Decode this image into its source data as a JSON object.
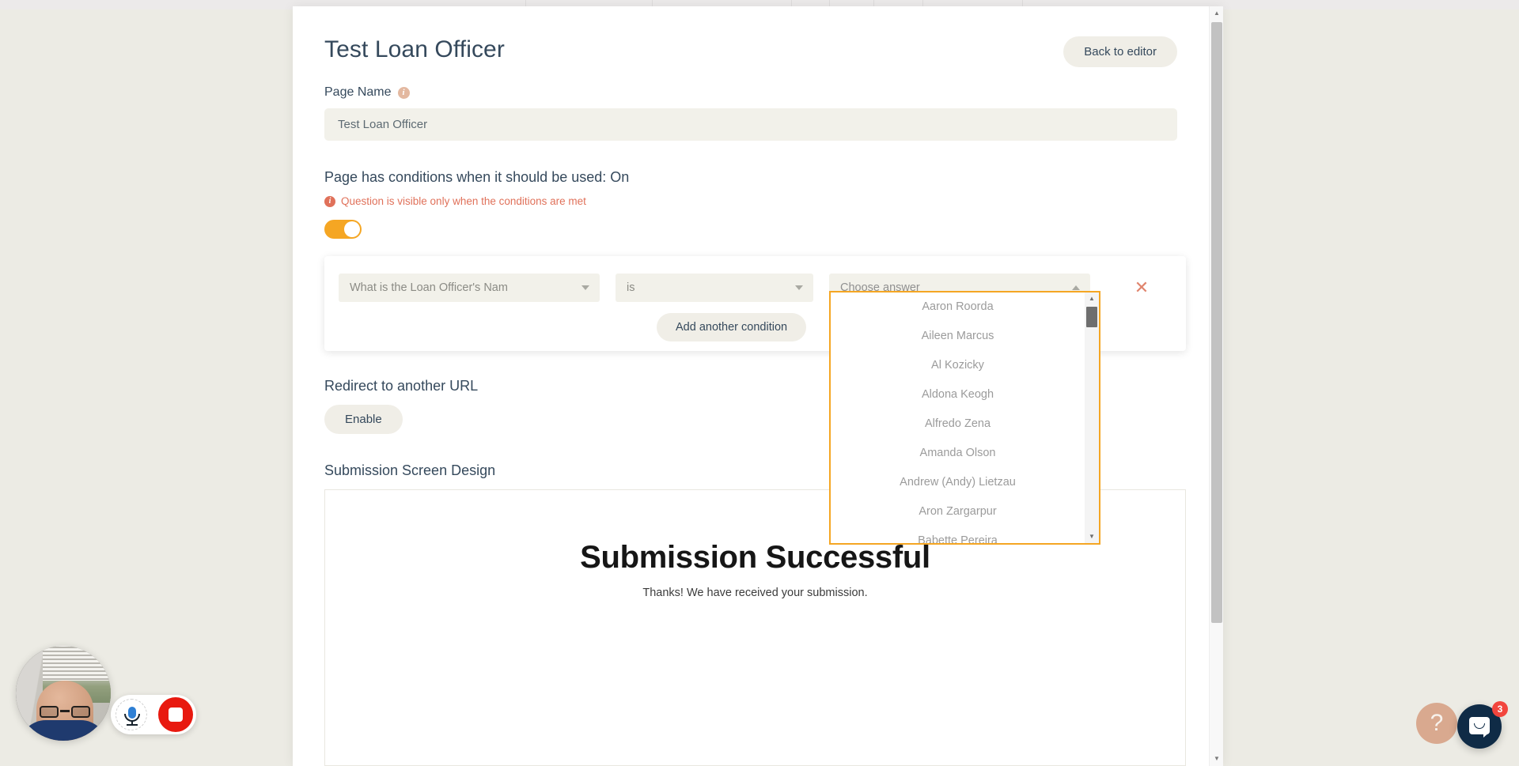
{
  "browser": {
    "tab_divider_positions": [
      664,
      824,
      1000,
      1048,
      1104,
      1166,
      1292
    ]
  },
  "header": {
    "page_title": "Test Loan Officer",
    "back_to_editor_label": "Back to editor"
  },
  "page_name": {
    "label": "Page Name",
    "info_icon": "info-icon",
    "info_glyph": "i",
    "value": "Test Loan Officer",
    "placeholder": "Page Name"
  },
  "conditions": {
    "heading": "Page has conditions when it should be used: On",
    "note_glyph": "i",
    "note": "Question is visible only when the conditions are met",
    "toggle_state": "on",
    "toggle_color": "#f5a623",
    "row": {
      "question_value": "What is the Loan Officer's Nam",
      "operator_value": "is",
      "answer_value": "Choose answer",
      "remove_glyph": "✕",
      "remove_color": "#e0846d"
    },
    "add_condition_label": "Add another condition"
  },
  "answer_dropdown": {
    "open": true,
    "border_color": "#f5a623",
    "scroll_up_glyph": "▲",
    "scroll_down_glyph": "▼",
    "options": [
      "Aaron Roorda",
      "Aileen Marcus",
      "Al Kozicky",
      "Aldona Keogh",
      "Alfredo Zena",
      "Amanda Olson",
      "Andrew (Andy) Lietzau",
      "Aron Zargarpur",
      "Babette Pereira"
    ]
  },
  "redirect": {
    "heading": "Redirect to another URL",
    "enable_label": "Enable"
  },
  "submission": {
    "heading": "Submission Screen Design",
    "preview_title": "Submission Successful",
    "preview_subtitle": "Thanks! We have received your submission."
  },
  "page_scrollbar": {
    "up_glyph": "▲",
    "down_glyph": "▼"
  },
  "recorder": {
    "mic_icon": "microphone-icon",
    "stop_icon": "stop-recording-icon",
    "webcam_icon": "webcam-preview"
  },
  "widgets": {
    "help_glyph": "?",
    "chat_icon": "chat-bubble-icon",
    "chat_badge_count": "3",
    "badge_color": "#f2453d"
  }
}
